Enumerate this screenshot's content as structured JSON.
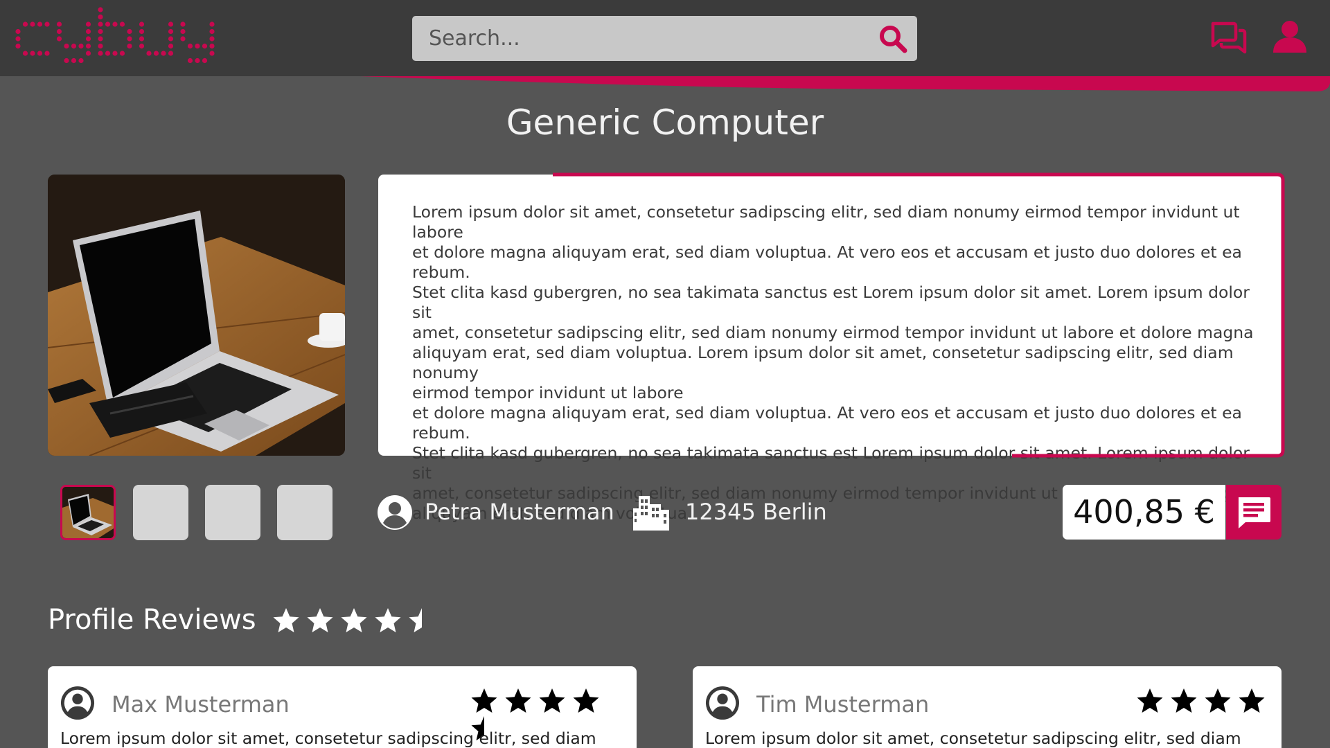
{
  "brand": {
    "logo_text": "cybuy",
    "accent_color": "#c8084f",
    "header_bg": "#3b3b3b",
    "page_bg": "#555555"
  },
  "header": {
    "search_placeholder": "Search...",
    "icons": [
      "search-icon",
      "chat-icon",
      "user-icon"
    ]
  },
  "product": {
    "title": "Generic Computer",
    "description": "Lorem ipsum dolor sit amet, consetetur sadipscing elitr, sed diam nonumy eirmod tempor invidunt ut labore\net dolore magna aliquyam erat, sed diam voluptua. At vero eos et accusam et justo duo dolores et ea rebum.\nStet clita kasd gubergren, no sea takimata sanctus est Lorem ipsum dolor sit amet. Lorem ipsum dolor sit\namet, consetetur sadipscing elitr, sed diam nonumy eirmod tempor invidunt ut labore et dolore magna\naliquyam erat, sed diam voluptua. Lorem ipsum dolor sit amet, consetetur sadipscing elitr, sed diam nonumy\neirmod tempor invidunt ut labore\net dolore magna aliquyam erat, sed diam voluptua. At vero eos et accusam et justo duo dolores et ea rebum.\nStet clita kasd gubergren, no sea takimata sanctus est Lorem ipsum dolor sit amet. Lorem ipsum dolor sit\namet, consetetur sadipscing elitr, sed diam nonumy eirmod tempor invidunt ut labore et dolore magna\naliquyam erat, sed diam voluptua.",
    "thumbnail_count": 4,
    "selected_thumbnail": 1,
    "seller_name": "Petra Musterman",
    "location": "12345 Berlin",
    "price": "400,85 €"
  },
  "reviews": {
    "title": "Profile Reviews",
    "overall_rating": 4.5,
    "items": [
      {
        "name": "Max Musterman",
        "rating": 4.5,
        "text": "Lorem ipsum dolor sit amet, consetetur sadipscing elitr, sed diam"
      },
      {
        "name": "Tim Musterman",
        "rating": 4,
        "text": "Lorem ipsum dolor sit amet, consetetur sadipscing elitr, sed diam"
      }
    ]
  }
}
